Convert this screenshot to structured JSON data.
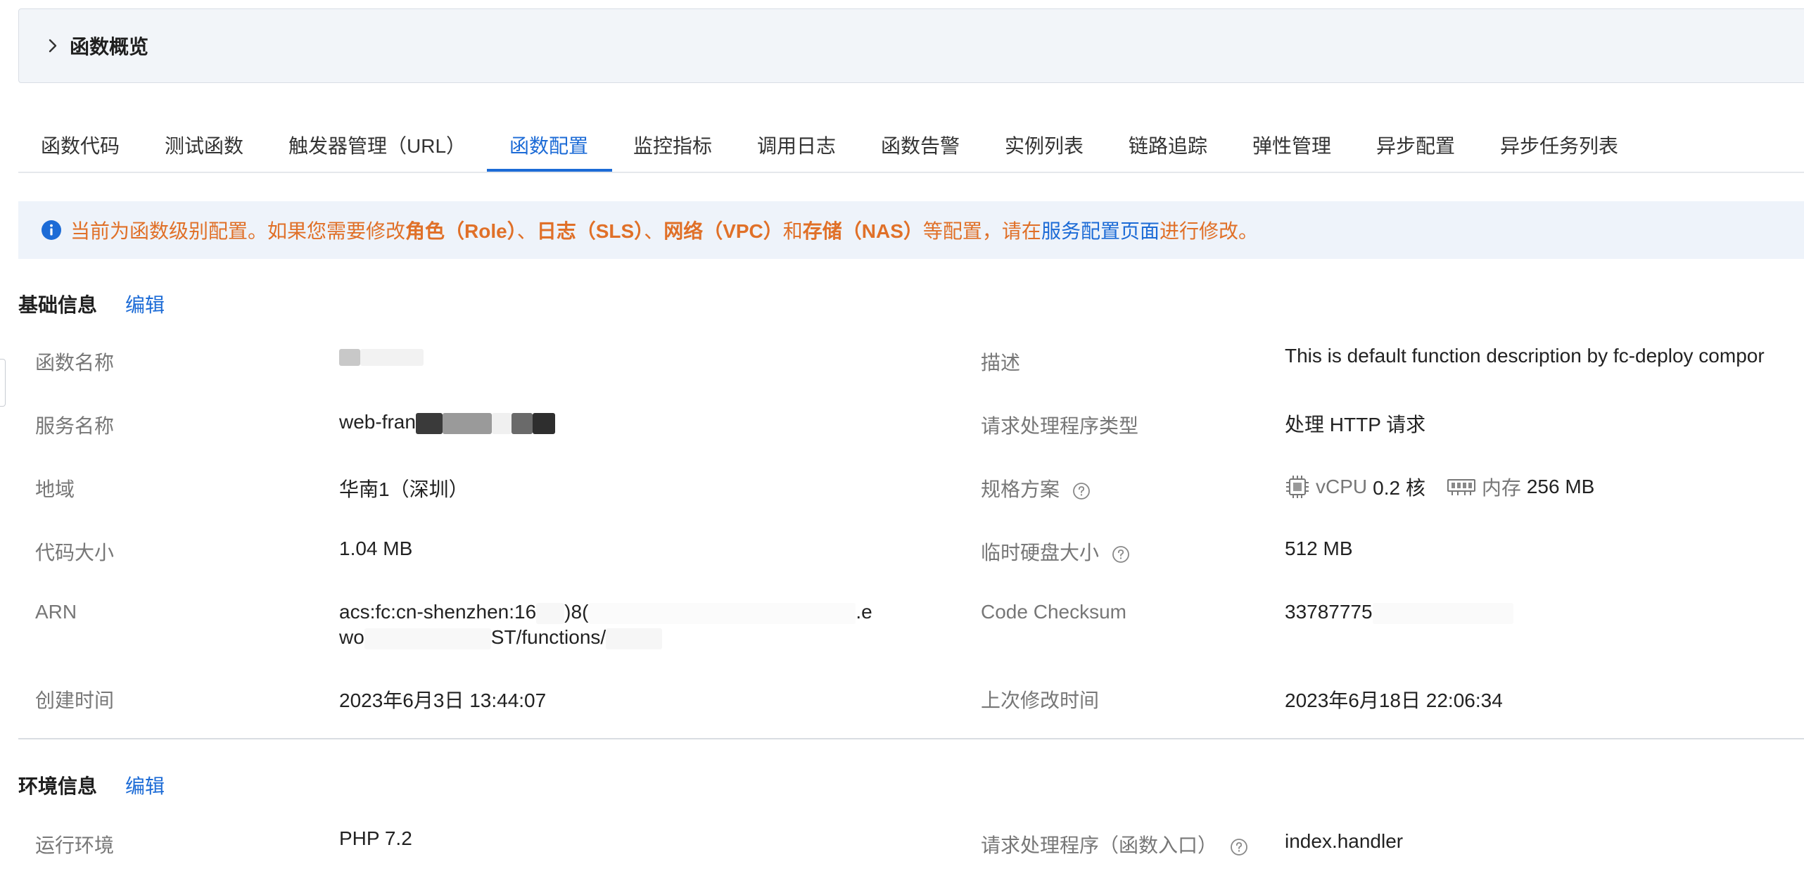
{
  "overview": {
    "title": "函数概览"
  },
  "tabs": [
    {
      "label": "函数代码"
    },
    {
      "label": "测试函数"
    },
    {
      "label": "触发器管理（URL）"
    },
    {
      "label": "函数配置"
    },
    {
      "label": "监控指标"
    },
    {
      "label": "调用日志"
    },
    {
      "label": "函数告警"
    },
    {
      "label": "实例列表"
    },
    {
      "label": "链路追踪"
    },
    {
      "label": "弹性管理"
    },
    {
      "label": "异步配置"
    },
    {
      "label": "异步任务列表"
    }
  ],
  "active_tab": "函数配置",
  "notice": {
    "p1": "当前为函数级别配置。如果您需要修改",
    "b1": "角色（Role）",
    "p2": "、",
    "b2": "日志（SLS）",
    "p3": "、",
    "b3": "网络（VPC）",
    "p4": "和",
    "b4": "存储（NAS）",
    "p5": "等配置，请在",
    "link": "服务配置页面",
    "p6": "进行修改。"
  },
  "basic": {
    "title": "基础信息",
    "edit": "编辑",
    "labels": {
      "function_name": "函数名称",
      "service_name": "服务名称",
      "region": "地域",
      "code_size": "代码大小",
      "arn": "ARN",
      "created": "创建时间",
      "description": "描述",
      "handler_type": "请求处理程序类型",
      "spec": "规格方案",
      "disk": "临时硬盘大小",
      "checksum": "Code Checksum",
      "modified": "上次修改时间"
    },
    "values": {
      "service_name_prefix": "web-fran",
      "region": "华南1（深圳）",
      "code_size": "1.04 MB",
      "arn_line1_a": "acs:fc:cn-shenzhen:16",
      "arn_line1_b": ")8(",
      "arn_line1_c": ".e",
      "arn_line2_a": "wo",
      "arn_line2_b": "ST/functions/",
      "created": "2023年6月3日 13:44:07",
      "description": "This is default function description by fc-deploy compor",
      "handler_type": "处理 HTTP 请求",
      "vcpu_label": "vCPU",
      "vcpu_value": "0.2 核",
      "mem_label": "内存",
      "mem_value": "256 MB",
      "disk": "512 MB",
      "checksum": "33787775",
      "modified": "2023年6月18日 22:06:34"
    }
  },
  "env": {
    "title": "环境信息",
    "edit": "编辑",
    "labels": {
      "runtime": "运行环境",
      "handler": "请求处理程序（函数入口）"
    },
    "values": {
      "runtime": "PHP 7.2",
      "handler": "index.handler"
    }
  },
  "colors": {
    "accent": "#1c6bd6",
    "notice_text": "#e07028",
    "notice_bg": "#eef3fa"
  }
}
